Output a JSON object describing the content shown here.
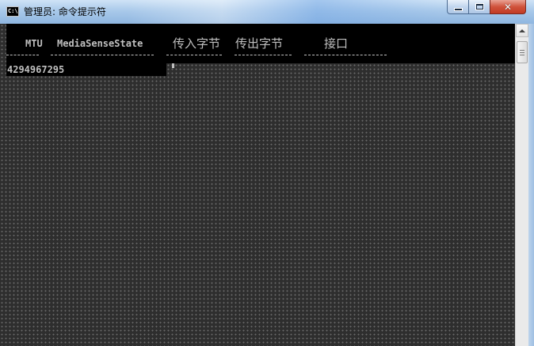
{
  "window": {
    "title": "管理员: 命令提示符",
    "app_icon": "C:\\"
  },
  "controls": {
    "minimize_icon": "minimize-icon",
    "maximize_icon": "maximize-icon",
    "close_glyph": "✕"
  },
  "console": {
    "headers": [
      "MTU",
      "MediaSenseState",
      "传入字节",
      "传出字节",
      "接口"
    ],
    "row_values": [
      "4294967295"
    ]
  },
  "colors": {
    "console_text": "#c0c0c0",
    "console_bg": "#000000",
    "close_button": "#c23a23"
  }
}
